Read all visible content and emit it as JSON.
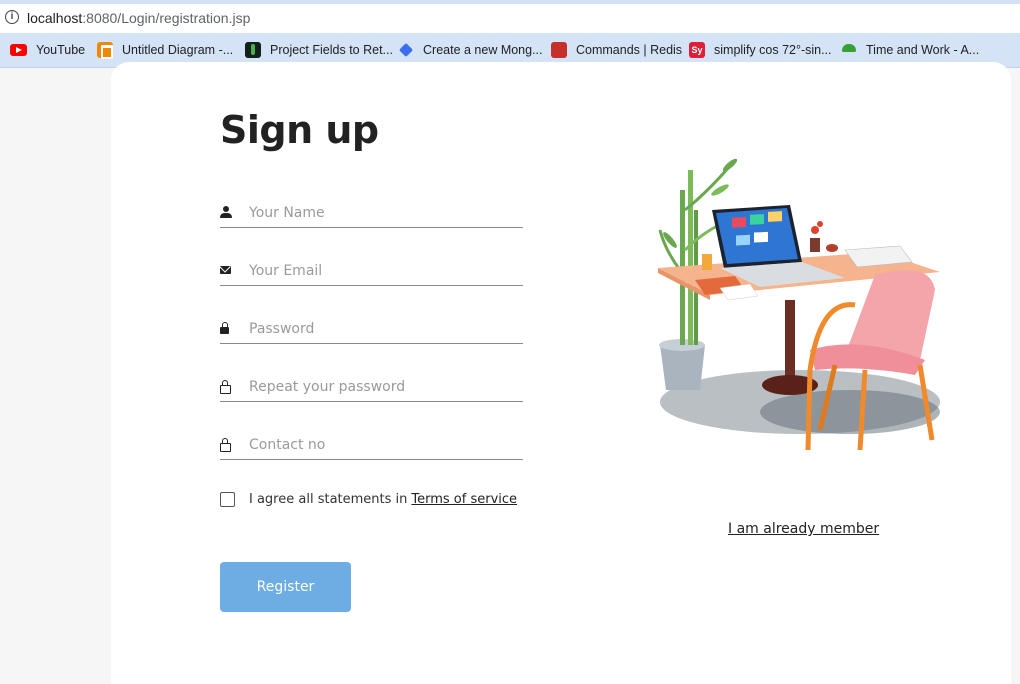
{
  "browser": {
    "url_host": "localhost",
    "url_rest": ":8080/Login/registration.jsp",
    "bookmarks": [
      {
        "label": "YouTube",
        "icon": "youtube-icon"
      },
      {
        "label": "Untitled Diagram -...",
        "icon": "drawio-icon"
      },
      {
        "label": "Project Fields to Ret...",
        "icon": "mongodb-leaf-icon"
      },
      {
        "label": "Create a new Mong...",
        "icon": "mongodb-diamond-icon"
      },
      {
        "label": "Commands | Redis",
        "icon": "redis-icon"
      },
      {
        "label": "simplify cos 72°-sin...",
        "icon": "symbolab-icon",
        "icon_text": "Sy"
      },
      {
        "label": "Time and Work - A...",
        "icon": "umbrella-icon"
      }
    ]
  },
  "form": {
    "title": "Sign up",
    "fields": [
      {
        "placeholder": "Your Name",
        "icon": "person-icon"
      },
      {
        "placeholder": "Your Email",
        "icon": "email-icon"
      },
      {
        "placeholder": "Password",
        "icon": "lock-icon"
      },
      {
        "placeholder": "Repeat your password",
        "icon": "lock-outline-icon"
      },
      {
        "placeholder": "Contact no",
        "icon": "lock-outline-icon"
      }
    ],
    "agree_text": "I agree all statements in",
    "terms_link": "Terms of service",
    "register_label": "Register",
    "member_link": "I am already member"
  },
  "colors": {
    "register_button": "#6dade4",
    "bookmarks_bar": "#d5e3f6",
    "page_background": "#f6f6f6"
  }
}
